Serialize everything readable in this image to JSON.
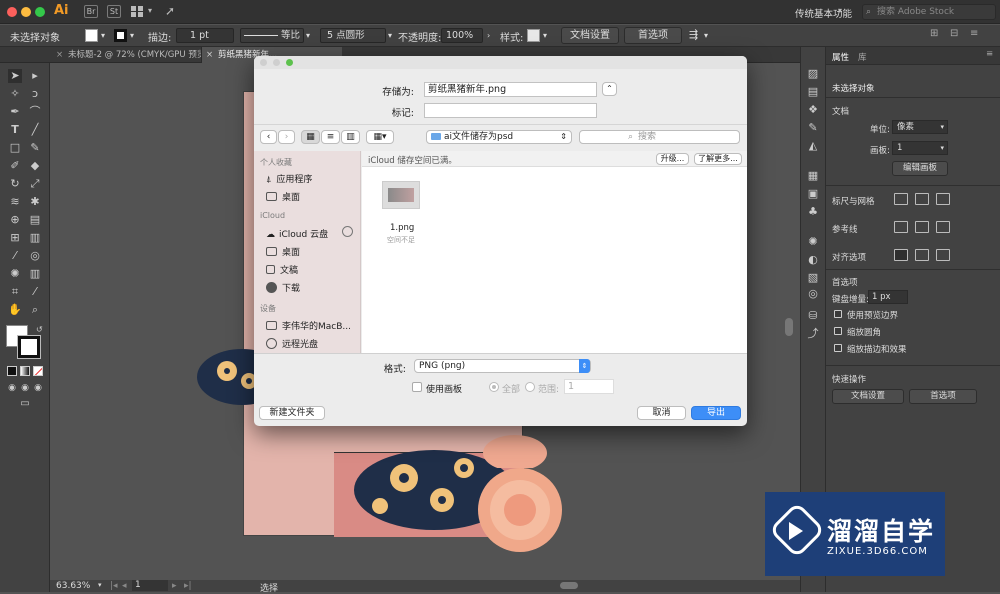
{
  "app": {
    "logo": "Ai",
    "br_badge": "Br",
    "st_badge": "St",
    "workspace": "传统基本功能",
    "stock_placeholder": "搜索 Adobe Stock"
  },
  "control_bar": {
    "selection_state": "未选择对象",
    "stroke_label": "描边:",
    "stroke_value": "1 pt",
    "stroke_style": "等比",
    "brush": "5 点圆形",
    "opacity_label": "不透明度:",
    "opacity_value": "100%",
    "style_label": "样式:",
    "doc_setup": "文档设置",
    "preferences": "首选项"
  },
  "tabs": [
    {
      "label": "未标题-2 @ 72% (CMYK/GPU 预览)"
    },
    {
      "label": "剪纸黑猪新年..."
    }
  ],
  "status": {
    "zoom": "63.63%",
    "page": "1",
    "mode": "选择"
  },
  "panel": {
    "tab_properties": "属性",
    "tab_library": "库",
    "no_selection": "未选择对象",
    "document": "文档",
    "unit_label": "单位:",
    "unit_value": "像素",
    "artboard_label": "画板:",
    "artboard_value": "1",
    "edit_artboards": "编辑画板",
    "rulers_grids": "标尺与网格",
    "guides": "参考线",
    "align_options": "对齐选项",
    "preferences": "首选项",
    "keyboard_increment_label": "键盘增量:",
    "keyboard_increment_value": "1 px",
    "use_preview_bounds": "使用预览边界",
    "scale_corners": "缩放圆角",
    "scale_strokes": "缩放描边和效果",
    "quick_actions": "快速操作",
    "doc_setup": "文档设置",
    "prefs_button": "首选项"
  },
  "dialog": {
    "save_as_label": "存储为:",
    "save_as_value": "剪纸黑猪新年.png",
    "tags_label": "标记:",
    "location": "ai文件储存为psd",
    "search_placeholder": "搜索",
    "sidebar_favorites": "个人收藏",
    "fav_apps": "应用程序",
    "fav_desktop": "桌面",
    "sidebar_icloud": "iCloud",
    "icloud_drive": "iCloud 云盘",
    "icloud_desktop": "桌面",
    "icloud_documents": "文稿",
    "icloud_downloads": "下载",
    "sidebar_devices": "设备",
    "device_mac": "李伟华的MacB...",
    "device_remote": "远程光盘",
    "icloud_notice": "iCloud 储存空间已满。",
    "upgrade": "升级...",
    "learn_more": "了解更多...",
    "file_name": "1.png",
    "file_status": "空间不足",
    "format_label": "格式:",
    "format_value": "PNG (png)",
    "use_artboards": "使用画板",
    "all": "全部",
    "range": "范围:",
    "range_value": "1",
    "new_folder": "新建文件夹",
    "cancel": "取消",
    "export": "导出"
  },
  "watermark": {
    "title": "溜溜自学",
    "url": "ZIXUE.3D66.COM"
  },
  "colors": {
    "ai_orange": "#f29a26",
    "accent_blue": "#3d8ef7",
    "watermark_blue": "#1e3f78"
  }
}
